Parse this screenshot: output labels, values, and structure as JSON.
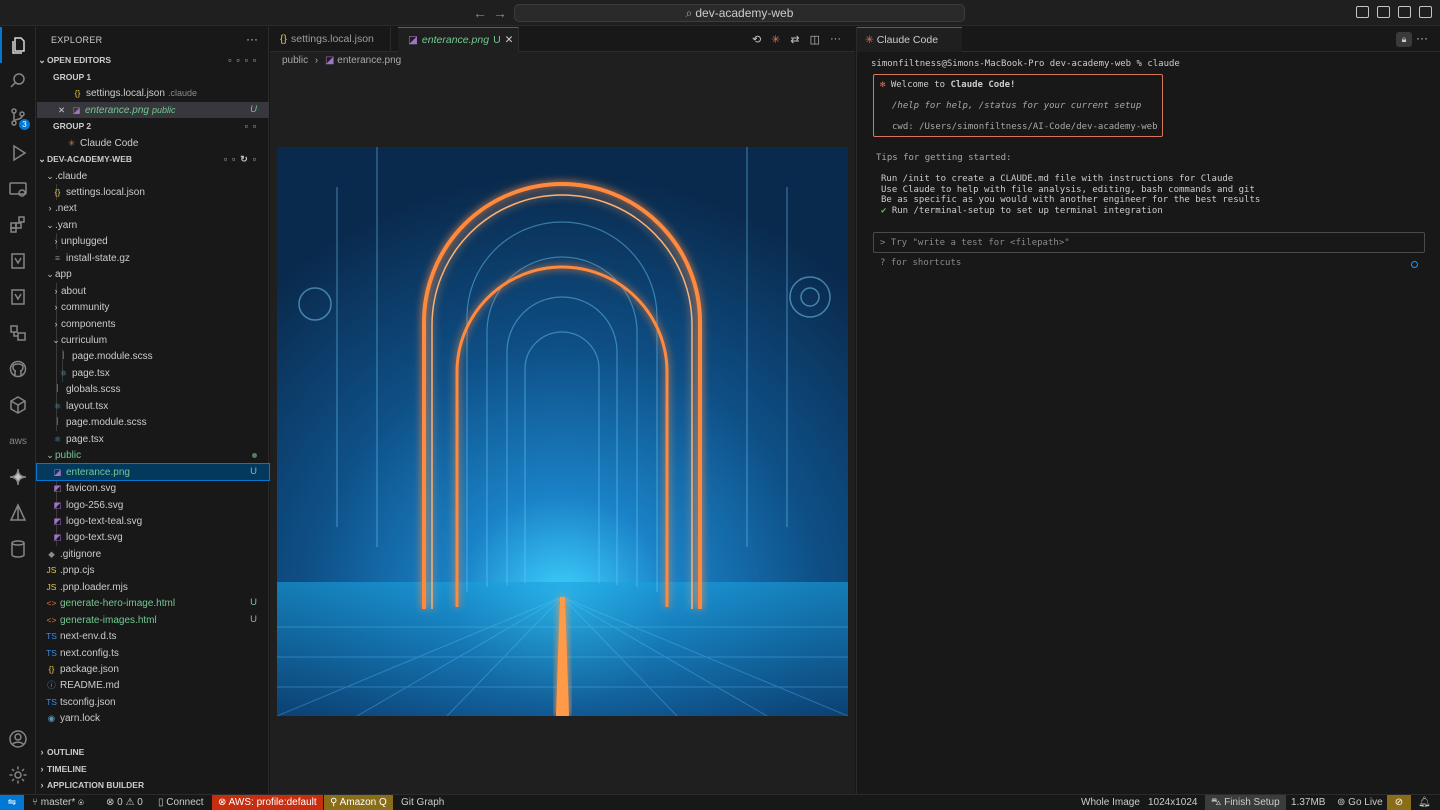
{
  "titlebar": {
    "search_text": "dev-academy-web"
  },
  "activity": {
    "scm_badge": "3",
    "aws_label": "aws"
  },
  "explorer": {
    "title": "EXPLORER",
    "open_editors": "OPEN EDITORS",
    "group1": "GROUP 1",
    "group1_file": "settings.local.json",
    "group1_file_dir": ".claude",
    "group1_file2": "enterance.png",
    "group1_file2_dir": "public",
    "group1_file2_git": "U",
    "group2": "GROUP 2",
    "group2_item": "Claude Code",
    "project": "DEV-ACADEMY-WEB",
    "tree": [
      {
        "label": ".claude",
        "type": "folder-open"
      },
      {
        "label": "settings.local.json",
        "type": "json"
      },
      {
        "label": ".next",
        "type": "folder"
      },
      {
        "label": ".yarn",
        "type": "folder-open"
      },
      {
        "label": "unplugged",
        "type": "folder"
      },
      {
        "label": "install-state.gz",
        "type": "file"
      },
      {
        "label": "app",
        "type": "folder-open"
      },
      {
        "label": "about",
        "type": "folder"
      },
      {
        "label": "community",
        "type": "folder"
      },
      {
        "label": "components",
        "type": "folder"
      },
      {
        "label": "curriculum",
        "type": "folder-open"
      },
      {
        "label": "page.module.scss",
        "type": "scss"
      },
      {
        "label": "page.tsx",
        "type": "tsx"
      },
      {
        "label": "globals.scss",
        "type": "scss"
      },
      {
        "label": "layout.tsx",
        "type": "tsx"
      },
      {
        "label": "page.module.scss",
        "type": "scss"
      },
      {
        "label": "page.tsx",
        "type": "tsx"
      },
      {
        "label": "public",
        "type": "folder-open"
      },
      {
        "label": "enterance.png",
        "type": "img",
        "git": "U"
      },
      {
        "label": "favicon.svg",
        "type": "svg"
      },
      {
        "label": "logo-256.svg",
        "type": "svg"
      },
      {
        "label": "logo-text-teal.svg",
        "type": "svg"
      },
      {
        "label": "logo-text.svg",
        "type": "svg"
      },
      {
        "label": ".gitignore",
        "type": "git"
      },
      {
        "label": ".pnp.cjs",
        "type": "js"
      },
      {
        "label": ".pnp.loader.mjs",
        "type": "js"
      },
      {
        "label": "generate-hero-image.html",
        "type": "html",
        "git": "U"
      },
      {
        "label": "generate-images.html",
        "type": "html",
        "git": "U"
      },
      {
        "label": "next-env.d.ts",
        "type": "ts"
      },
      {
        "label": "next.config.ts",
        "type": "ts"
      },
      {
        "label": "package.json",
        "type": "json"
      },
      {
        "label": "README.md",
        "type": "info"
      },
      {
        "label": "tsconfig.json",
        "type": "tsconfig"
      },
      {
        "label": "yarn.lock",
        "type": "yarn"
      }
    ],
    "icons": {
      "json": "{}",
      "js": "JS",
      "ts": "TS",
      "tsconfig": "TS",
      "html": "<>",
      "tsx": "⚛",
      "scss": "ꟾ",
      "svg": "◩",
      "img": "◪",
      "git": "◆",
      "info": "ⓘ",
      "yarn": "◉",
      "file": "≡"
    },
    "outline": "OUTLINE",
    "timeline": "TIMELINE",
    "app_builder": "APPLICATION BUILDER"
  },
  "editor": {
    "tab1": "settings.local.json",
    "tab2": "enterance.png",
    "tab2_git": "U",
    "crumb1": "public",
    "crumb2": "enterance.png"
  },
  "panel": {
    "tab": "Claude Code",
    "prompt_line": "simonfiltness@Simons-MacBook-Pro dev-academy-web % claude",
    "welcome_prefix": "Welcome to ",
    "welcome_name": "Claude Code!",
    "help_line": "/help for help, /status for your current setup",
    "cwd_line": "cwd: /Users/simonfiltness/AI-Code/dev-academy-web",
    "tips_title": "Tips for getting started:",
    "tips": [
      "Run /init to create a CLAUDE.md file with instructions for Claude",
      "Use Claude to help with file analysis, editing, bash commands and git",
      "Be as specific as you would with another engineer for the best results"
    ],
    "tip_done": "Run /terminal-setup to set up terminal integration",
    "input_placeholder": "Try \"write a test for <filepath>\"",
    "shortcuts": "? for shortcuts"
  },
  "status": {
    "branch": "master*",
    "errors": "0",
    "warnings": "0",
    "connect": "Connect",
    "aws": "AWS: profile:default",
    "amazon_q": "Amazon Q",
    "git_graph": "Git Graph",
    "whole_image": "Whole Image",
    "dims": "1024x1024",
    "finish_setup": "Finish Setup",
    "size": "1.37MB",
    "go_live": "Go Live"
  }
}
